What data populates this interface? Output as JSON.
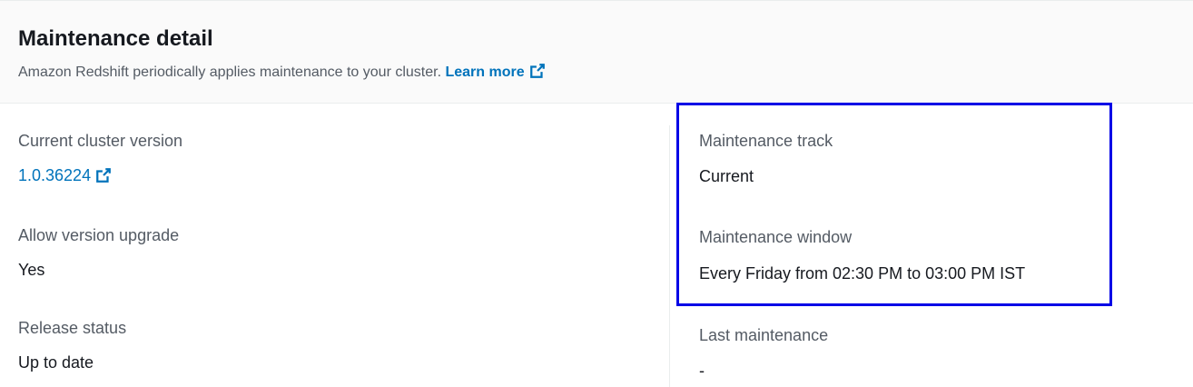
{
  "header": {
    "title": "Maintenance detail",
    "description": "Amazon Redshift periodically applies maintenance to your cluster.",
    "learn_more_label": "Learn more",
    "learn_more_icon": "external-link-icon"
  },
  "left_column": {
    "cluster_version": {
      "label": "Current cluster version",
      "value": "1.0.36224",
      "icon": "external-link-icon"
    },
    "allow_upgrade": {
      "label": "Allow version upgrade",
      "value": "Yes"
    },
    "release_status": {
      "label": "Release status",
      "value": "Up to date"
    }
  },
  "right_column": {
    "maintenance_track": {
      "label": "Maintenance track",
      "value": "Current"
    },
    "maintenance_window": {
      "label": "Maintenance window",
      "value": "Every Friday from 02:30 PM to 03:00 PM IST"
    },
    "last_maintenance": {
      "label": "Last maintenance",
      "value": "-"
    }
  },
  "colors": {
    "link": "#0073bb",
    "highlight_box": "#0000e6",
    "label": "#545b64",
    "text": "#16191f"
  }
}
